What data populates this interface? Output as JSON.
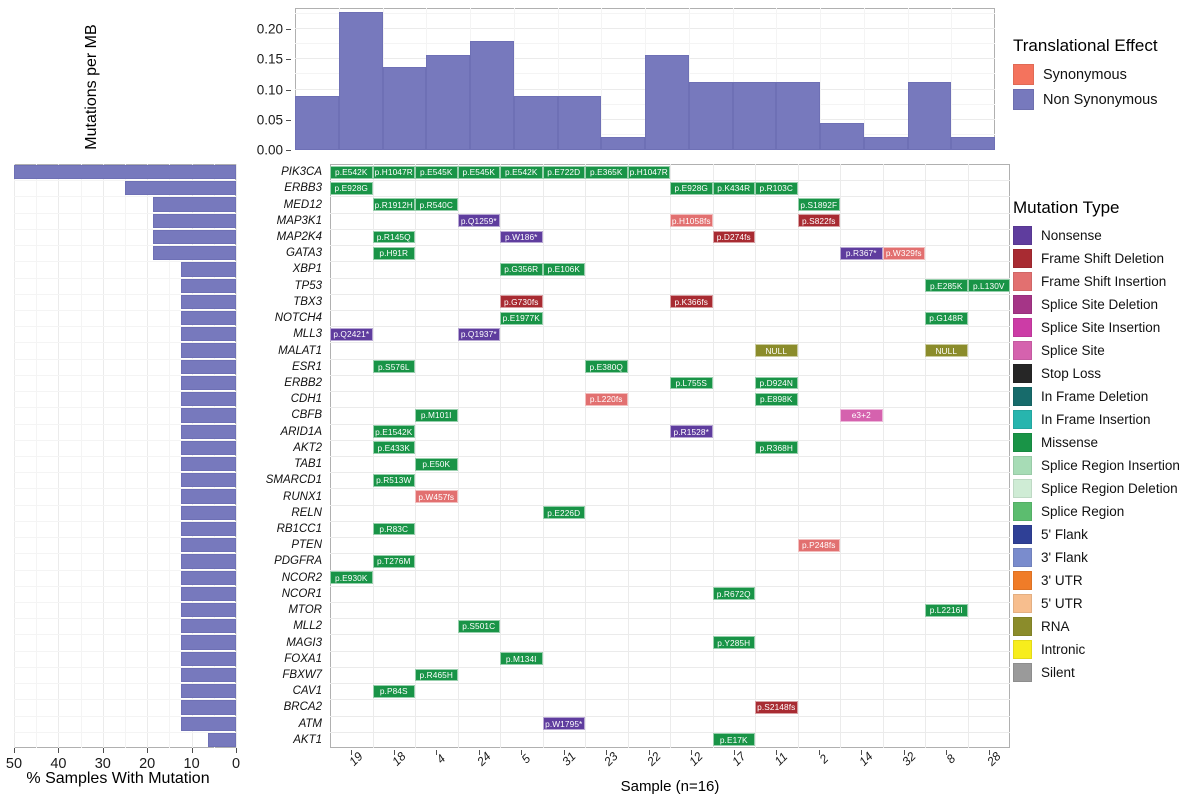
{
  "top_chart": {
    "ylabel": "Mutations per MB",
    "yticks": [
      "0.00",
      "0.05",
      "0.10",
      "0.15",
      "0.20"
    ],
    "ytick_values": [
      0.0,
      0.05,
      0.1,
      0.15,
      0.2
    ],
    "bar_color": "#7779bd"
  },
  "left_chart": {
    "xlabel": "% Samples With Mutation",
    "xticks": [
      "50",
      "40",
      "30",
      "20",
      "10",
      "0"
    ],
    "xtick_values": [
      50,
      40,
      30,
      20,
      10,
      0
    ],
    "bar_color": "#7779bd"
  },
  "main": {
    "xlabel": "Sample (n=16)",
    "samples": [
      "19",
      "18",
      "4",
      "24",
      "5",
      "31",
      "23",
      "22",
      "12",
      "17",
      "11",
      "2",
      "14",
      "32",
      "8",
      "28"
    ],
    "genes": [
      "PIK3CA",
      "ERBB3",
      "MED12",
      "MAP3K1",
      "MAP2K4",
      "GATA3",
      "XBP1",
      "TP53",
      "TBX3",
      "NOTCH4",
      "MLL3",
      "MALAT1",
      "ESR1",
      "ERBB2",
      "CDH1",
      "CBFB",
      "ARID1A",
      "AKT2",
      "TAB1",
      "SMARCD1",
      "RUNX1",
      "RELN",
      "RB1CC1",
      "PTEN",
      "PDGFRA",
      "NCOR2",
      "NCOR1",
      "MTOR",
      "MLL2",
      "MAGI3",
      "FOXA1",
      "FBXW7",
      "CAV1",
      "BRCA2",
      "ATM",
      "AKT1"
    ]
  },
  "legend_effect": {
    "title": "Translational Effect",
    "items": [
      {
        "label": "Synonymous",
        "color": "#f4735d"
      },
      {
        "label": "Non Synonymous",
        "color": "#7779bd"
      }
    ]
  },
  "legend_mutation": {
    "title": "Mutation Type",
    "items": [
      {
        "label": "Nonsense",
        "color": "#5f3d9e"
      },
      {
        "label": "Frame Shift Deletion",
        "color": "#a82b32"
      },
      {
        "label": "Frame Shift Insertion",
        "color": "#e27070"
      },
      {
        "label": "Splice Site Deletion",
        "color": "#a53587"
      },
      {
        "label": "Splice Site Insertion",
        "color": "#cc3ca6"
      },
      {
        "label": "Splice Site",
        "color": "#d562ae"
      },
      {
        "label": "Stop Loss",
        "color": "#262626"
      },
      {
        "label": "In Frame Deletion",
        "color": "#176b6b"
      },
      {
        "label": "In Frame Insertion",
        "color": "#27b5ae"
      },
      {
        "label": "Missense",
        "color": "#199447"
      },
      {
        "label": "Splice Region Insertion",
        "color": "#a7dcb6"
      },
      {
        "label": "Splice Region Deletion",
        "color": "#cfecd5"
      },
      {
        "label": "Splice Region",
        "color": "#5cbd6f"
      },
      {
        "label": "5' Flank",
        "color": "#2f4096"
      },
      {
        "label": "3' Flank",
        "color": "#7a8ccd"
      },
      {
        "label": "3' UTR",
        "color": "#f07c28"
      },
      {
        "label": "5' UTR",
        "color": "#f7be8e"
      },
      {
        "label": "RNA",
        "color": "#8b8c2b"
      },
      {
        "label": "Intronic",
        "color": "#f7ed1c"
      },
      {
        "label": "Silent",
        "color": "#9a9a9a"
      }
    ]
  },
  "chart_data": [
    {
      "type": "bar",
      "name": "mutation-burden",
      "title": "",
      "xlabel": "",
      "ylabel": "Mutations per MB",
      "categories": [
        "19",
        "18",
        "4",
        "24",
        "5",
        "31",
        "23",
        "22",
        "12",
        "17",
        "11",
        "2",
        "14",
        "32",
        "8",
        "28"
      ],
      "values": [
        0.09,
        0.228,
        0.137,
        0.158,
        0.181,
        0.09,
        0.09,
        0.022,
        0.158,
        0.113,
        0.113,
        0.113,
        0.045,
        0.022,
        0.113,
        0.022
      ],
      "ylim": [
        0,
        0.235
      ],
      "yticks": [
        0.0,
        0.05,
        0.1,
        0.15,
        0.2
      ],
      "grid": true,
      "legend_position": "right",
      "series": [
        {
          "name": "Non Synonymous",
          "color": "#7779bd"
        }
      ]
    },
    {
      "type": "bar",
      "name": "percent-samples-with-mutation",
      "orientation": "horizontal",
      "title": "",
      "xlabel": "% Samples With Mutation",
      "ylabel": "",
      "xlim": [
        50,
        0
      ],
      "reversed_x": true,
      "xticks": [
        50,
        40,
        30,
        20,
        10,
        0
      ],
      "categories": [
        "PIK3CA",
        "ERBB3",
        "MED12",
        "MAP3K1",
        "MAP2K4",
        "GATA3",
        "XBP1",
        "TP53",
        "TBX3",
        "NOTCH4",
        "MLL3",
        "MALAT1",
        "ESR1",
        "ERBB2",
        "CDH1",
        "CBFB",
        "ARID1A",
        "AKT2",
        "TAB1",
        "SMARCD1",
        "RUNX1",
        "RELN",
        "RB1CC1",
        "PTEN",
        "PDGFRA",
        "NCOR2",
        "NCOR1",
        "MTOR",
        "MLL2",
        "MAGI3",
        "FOXA1",
        "FBXW7",
        "CAV1",
        "BRCA2",
        "ATM",
        "AKT1"
      ],
      "values": [
        50.0,
        25.0,
        18.75,
        18.75,
        18.75,
        18.75,
        12.5,
        12.5,
        12.5,
        12.5,
        12.5,
        12.5,
        12.5,
        12.5,
        12.5,
        12.5,
        12.5,
        12.5,
        12.5,
        12.5,
        12.5,
        12.5,
        12.5,
        12.5,
        12.5,
        12.5,
        12.5,
        12.5,
        12.5,
        12.5,
        12.5,
        12.5,
        12.5,
        12.5,
        12.5,
        6.25
      ],
      "grid": true
    },
    {
      "type": "heatmap",
      "name": "oncoprint-mutation-grid",
      "title": "",
      "xlabel": "Sample (n=16)",
      "ylabel": "",
      "x": [
        "19",
        "18",
        "4",
        "24",
        "5",
        "31",
        "23",
        "22",
        "12",
        "17",
        "11",
        "2",
        "14",
        "32",
        "8",
        "28"
      ],
      "y": [
        "PIK3CA",
        "ERBB3",
        "MED12",
        "MAP3K1",
        "MAP2K4",
        "GATA3",
        "XBP1",
        "TP53",
        "TBX3",
        "NOTCH4",
        "MLL3",
        "MALAT1",
        "ESR1",
        "ERBB2",
        "CDH1",
        "CBFB",
        "ARID1A",
        "AKT2",
        "TAB1",
        "SMARCD1",
        "RUNX1",
        "RELN",
        "RB1CC1",
        "PTEN",
        "PDGFRA",
        "NCOR2",
        "NCOR1",
        "MTOR",
        "MLL2",
        "MAGI3",
        "FOXA1",
        "FBXW7",
        "CAV1",
        "BRCA2",
        "ATM",
        "AKT1"
      ],
      "cells": [
        {
          "gene": "PIK3CA",
          "sample": "19",
          "label": "p.E542K",
          "type": "Missense"
        },
        {
          "gene": "PIK3CA",
          "sample": "18",
          "label": "p.H1047R",
          "type": "Missense"
        },
        {
          "gene": "PIK3CA",
          "sample": "4",
          "label": "p.E545K",
          "type": "Missense"
        },
        {
          "gene": "PIK3CA",
          "sample": "24",
          "label": "p.E545K",
          "type": "Missense"
        },
        {
          "gene": "PIK3CA",
          "sample": "5",
          "label": "p.E542K",
          "type": "Missense"
        },
        {
          "gene": "PIK3CA",
          "sample": "31",
          "label": "p.E722D",
          "type": "Missense"
        },
        {
          "gene": "PIK3CA",
          "sample": "23",
          "label": "p.E365K",
          "type": "Missense"
        },
        {
          "gene": "PIK3CA",
          "sample": "22",
          "label": "p.H1047R",
          "type": "Missense"
        },
        {
          "gene": "ERBB3",
          "sample": "19",
          "label": "p.E928G",
          "type": "Missense"
        },
        {
          "gene": "ERBB3",
          "sample": "12",
          "label": "p.E928G",
          "type": "Missense"
        },
        {
          "gene": "ERBB3",
          "sample": "17",
          "label": "p.K434R",
          "type": "Missense"
        },
        {
          "gene": "ERBB3",
          "sample": "11",
          "label": "p.R103C",
          "type": "Missense"
        },
        {
          "gene": "MED12",
          "sample": "18",
          "label": "p.R1912H",
          "type": "Missense"
        },
        {
          "gene": "MED12",
          "sample": "4",
          "label": "p.R540C",
          "type": "Missense"
        },
        {
          "gene": "MED12",
          "sample": "2",
          "label": "p.S1892F",
          "type": "Missense"
        },
        {
          "gene": "MAP3K1",
          "sample": "24",
          "label": "p.Q1259*",
          "type": "Nonsense"
        },
        {
          "gene": "MAP3K1",
          "sample": "12",
          "label": "p.H1058fs",
          "type": "Frame Shift Insertion"
        },
        {
          "gene": "MAP3K1",
          "sample": "2",
          "label": "p.S822fs",
          "type": "Frame Shift Deletion"
        },
        {
          "gene": "MAP2K4",
          "sample": "18",
          "label": "p.R145Q",
          "type": "Missense"
        },
        {
          "gene": "MAP2K4",
          "sample": "5",
          "label": "p.W186*",
          "type": "Nonsense"
        },
        {
          "gene": "MAP2K4",
          "sample": "17",
          "label": "p.D274fs",
          "type": "Frame Shift Deletion"
        },
        {
          "gene": "GATA3",
          "sample": "18",
          "label": "p.H91R",
          "type": "Missense"
        },
        {
          "gene": "GATA3",
          "sample": "14",
          "label": "p.R367*",
          "type": "Nonsense"
        },
        {
          "gene": "GATA3",
          "sample": "32",
          "label": "p.W329fs",
          "type": "Frame Shift Insertion"
        },
        {
          "gene": "XBP1",
          "sample": "5",
          "label": "p.G356R",
          "type": "Missense"
        },
        {
          "gene": "XBP1",
          "sample": "31",
          "label": "p.E106K",
          "type": "Missense"
        },
        {
          "gene": "TP53",
          "sample": "8",
          "label": "p.E285K",
          "type": "Missense"
        },
        {
          "gene": "TP53",
          "sample": "28",
          "label": "p.L130V",
          "type": "Missense"
        },
        {
          "gene": "TBX3",
          "sample": "5",
          "label": "p.G730fs",
          "type": "Frame Shift Deletion"
        },
        {
          "gene": "TBX3",
          "sample": "12",
          "label": "p.K366fs",
          "type": "Frame Shift Deletion"
        },
        {
          "gene": "NOTCH4",
          "sample": "5",
          "label": "p.E1977K",
          "type": "Missense"
        },
        {
          "gene": "NOTCH4",
          "sample": "8",
          "label": "p.G148R",
          "type": "Missense"
        },
        {
          "gene": "MLL3",
          "sample": "19",
          "label": "p.Q2421*",
          "type": "Nonsense"
        },
        {
          "gene": "MLL3",
          "sample": "24",
          "label": "p.Q1937*",
          "type": "Nonsense"
        },
        {
          "gene": "MALAT1",
          "sample": "11",
          "label": "NULL",
          "type": "RNA"
        },
        {
          "gene": "MALAT1",
          "sample": "8",
          "label": "NULL",
          "type": "RNA"
        },
        {
          "gene": "ESR1",
          "sample": "18",
          "label": "p.S576L",
          "type": "Missense"
        },
        {
          "gene": "ESR1",
          "sample": "23",
          "label": "p.E380Q",
          "type": "Missense"
        },
        {
          "gene": "ERBB2",
          "sample": "12",
          "label": "p.L755S",
          "type": "Missense"
        },
        {
          "gene": "ERBB2",
          "sample": "11",
          "label": "p.D924N",
          "type": "Missense"
        },
        {
          "gene": "CDH1",
          "sample": "23",
          "label": "p.L220fs",
          "type": "Frame Shift Insertion"
        },
        {
          "gene": "CDH1",
          "sample": "11",
          "label": "p.E898K",
          "type": "Missense"
        },
        {
          "gene": "CBFB",
          "sample": "4",
          "label": "p.M101I",
          "type": "Missense"
        },
        {
          "gene": "CBFB",
          "sample": "14",
          "label": "e3+2",
          "type": "Splice Site"
        },
        {
          "gene": "ARID1A",
          "sample": "18",
          "label": "p.E1542K",
          "type": "Missense"
        },
        {
          "gene": "ARID1A",
          "sample": "12",
          "label": "p.R1528*",
          "type": "Nonsense"
        },
        {
          "gene": "AKT2",
          "sample": "18",
          "label": "p.E433K",
          "type": "Missense"
        },
        {
          "gene": "AKT2",
          "sample": "11",
          "label": "p.R368H",
          "type": "Missense"
        },
        {
          "gene": "TAB1",
          "sample": "4",
          "label": "p.E50K",
          "type": "Missense"
        },
        {
          "gene": "SMARCD1",
          "sample": "18",
          "label": "p.R513W",
          "type": "Missense"
        },
        {
          "gene": "RUNX1",
          "sample": "4",
          "label": "p.W457fs",
          "type": "Frame Shift Insertion"
        },
        {
          "gene": "RELN",
          "sample": "31",
          "label": "p.E226D",
          "type": "Missense"
        },
        {
          "gene": "RB1CC1",
          "sample": "18",
          "label": "p.R83C",
          "type": "Missense"
        },
        {
          "gene": "PTEN",
          "sample": "2",
          "label": "p.P248fs",
          "type": "Frame Shift Insertion"
        },
        {
          "gene": "PDGFRA",
          "sample": "18",
          "label": "p.T276M",
          "type": "Missense"
        },
        {
          "gene": "NCOR2",
          "sample": "19",
          "label": "p.E930K",
          "type": "Missense"
        },
        {
          "gene": "NCOR1",
          "sample": "17",
          "label": "p.R672Q",
          "type": "Missense"
        },
        {
          "gene": "MTOR",
          "sample": "8",
          "label": "p.L2216I",
          "type": "Missense"
        },
        {
          "gene": "MLL2",
          "sample": "24",
          "label": "p.S501C",
          "type": "Missense"
        },
        {
          "gene": "MAGI3",
          "sample": "17",
          "label": "p.Y285H",
          "type": "Missense"
        },
        {
          "gene": "FOXA1",
          "sample": "5",
          "label": "p.M134I",
          "type": "Missense"
        },
        {
          "gene": "FBXW7",
          "sample": "4",
          "label": "p.R465H",
          "type": "Missense"
        },
        {
          "gene": "CAV1",
          "sample": "18",
          "label": "p.P84S",
          "type": "Missense"
        },
        {
          "gene": "BRCA2",
          "sample": "11",
          "label": "p.S2148fs",
          "type": "Frame Shift Deletion"
        },
        {
          "gene": "ATM",
          "sample": "31",
          "label": "p.W1795*",
          "type": "Nonsense"
        },
        {
          "gene": "AKT1",
          "sample": "17",
          "label": "p.E17K",
          "type": "Missense"
        }
      ]
    }
  ]
}
